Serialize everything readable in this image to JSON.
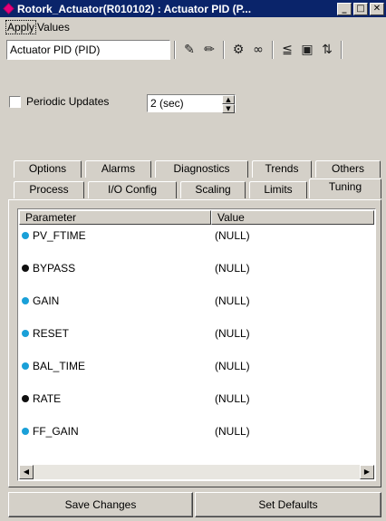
{
  "window": {
    "title": "Rotork_Actuator(R010102) : Actuator PID (P..."
  },
  "menu": {
    "apply": "Apply",
    "values": "Values"
  },
  "toolbar": {
    "object_name": "Actuator PID (PID)",
    "icons": [
      "pencil-icon",
      "pen-icon",
      "link-icon",
      "glasses-icon",
      "edit-grid-icon",
      "folder-icon",
      "arrows-icon"
    ]
  },
  "periodic": {
    "label": "Periodic Updates",
    "checked": false,
    "interval": "2 (sec)"
  },
  "tabs": {
    "row1": [
      "Options",
      "Alarms",
      "Diagnostics",
      "Trends",
      "Others"
    ],
    "row2": [
      "Process",
      "I/O Config",
      "Scaling",
      "Limits",
      "Tuning"
    ],
    "active": "Tuning"
  },
  "grid": {
    "columns": [
      "Parameter",
      "Value"
    ],
    "rows": [
      {
        "name": "PV_FTIME",
        "value": "(NULL)",
        "dot": "#1aa0d8"
      },
      {
        "name": "BYPASS",
        "value": "(NULL)",
        "dot": "#101010"
      },
      {
        "name": "GAIN",
        "value": "(NULL)",
        "dot": "#1aa0d8"
      },
      {
        "name": "RESET",
        "value": "(NULL)",
        "dot": "#1aa0d8"
      },
      {
        "name": "BAL_TIME",
        "value": "(NULL)",
        "dot": "#1aa0d8"
      },
      {
        "name": "RATE",
        "value": "(NULL)",
        "dot": "#101010"
      },
      {
        "name": "FF_GAIN",
        "value": "(NULL)",
        "dot": "#1aa0d8"
      }
    ]
  },
  "buttons": {
    "save": "Save Changes",
    "defaults": "Set Defaults"
  },
  "colors": {
    "titlebar": "#0a246a",
    "face": "#d4d0c8"
  }
}
